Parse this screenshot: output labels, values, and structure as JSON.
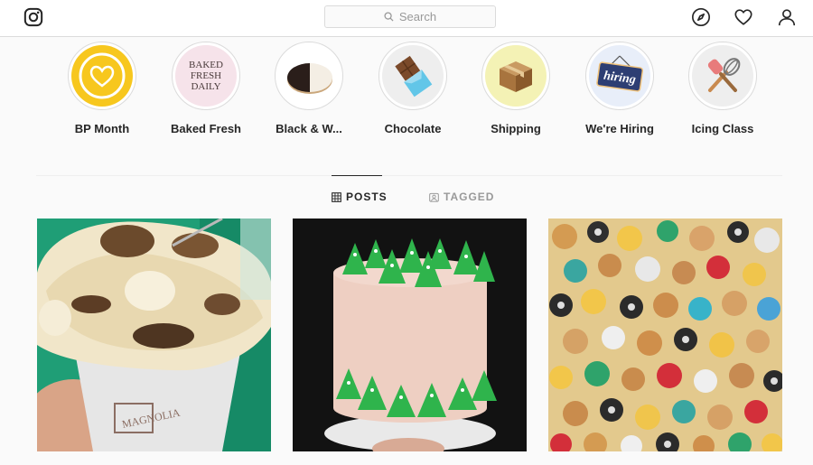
{
  "search": {
    "placeholder": "Search"
  },
  "highlights": [
    {
      "label": "BP Month",
      "cover_icon": "heart-icon",
      "cover_color": "#f7c71e"
    },
    {
      "label": "Baked Fresh",
      "cover_icon": "text-badge",
      "cover_text": [
        "BAKED",
        "FRESH",
        "DAILY"
      ],
      "cover_color": "#f6e3ea"
    },
    {
      "label": "Black & W...",
      "cover_icon": "black-and-white-cookie",
      "cover_color": "#ffffff"
    },
    {
      "label": "Chocolate",
      "cover_icon": "chocolate-bar-icon",
      "cover_color": "#eeeeee"
    },
    {
      "label": "Shipping",
      "cover_icon": "box-icon",
      "cover_color": "#f4f2b5"
    },
    {
      "label": "We're Hiring",
      "cover_icon": "hiring-sign-icon",
      "cover_text": [
        "hiring"
      ],
      "cover_color": "#e8eef9"
    },
    {
      "label": "Icing Class",
      "cover_icon": "whisk-spatula-icon",
      "cover_color": "#eeeeee"
    }
  ],
  "tabs": [
    {
      "label": "POSTS",
      "icon": "grid-icon",
      "active": true
    },
    {
      "label": "TAGGED",
      "icon": "tagged-icon",
      "active": false
    }
  ],
  "posts": [
    {
      "subject": "banana pudding cup"
    },
    {
      "subject": "christmas tree cake"
    },
    {
      "subject": "assorted holiday cookies"
    }
  ]
}
